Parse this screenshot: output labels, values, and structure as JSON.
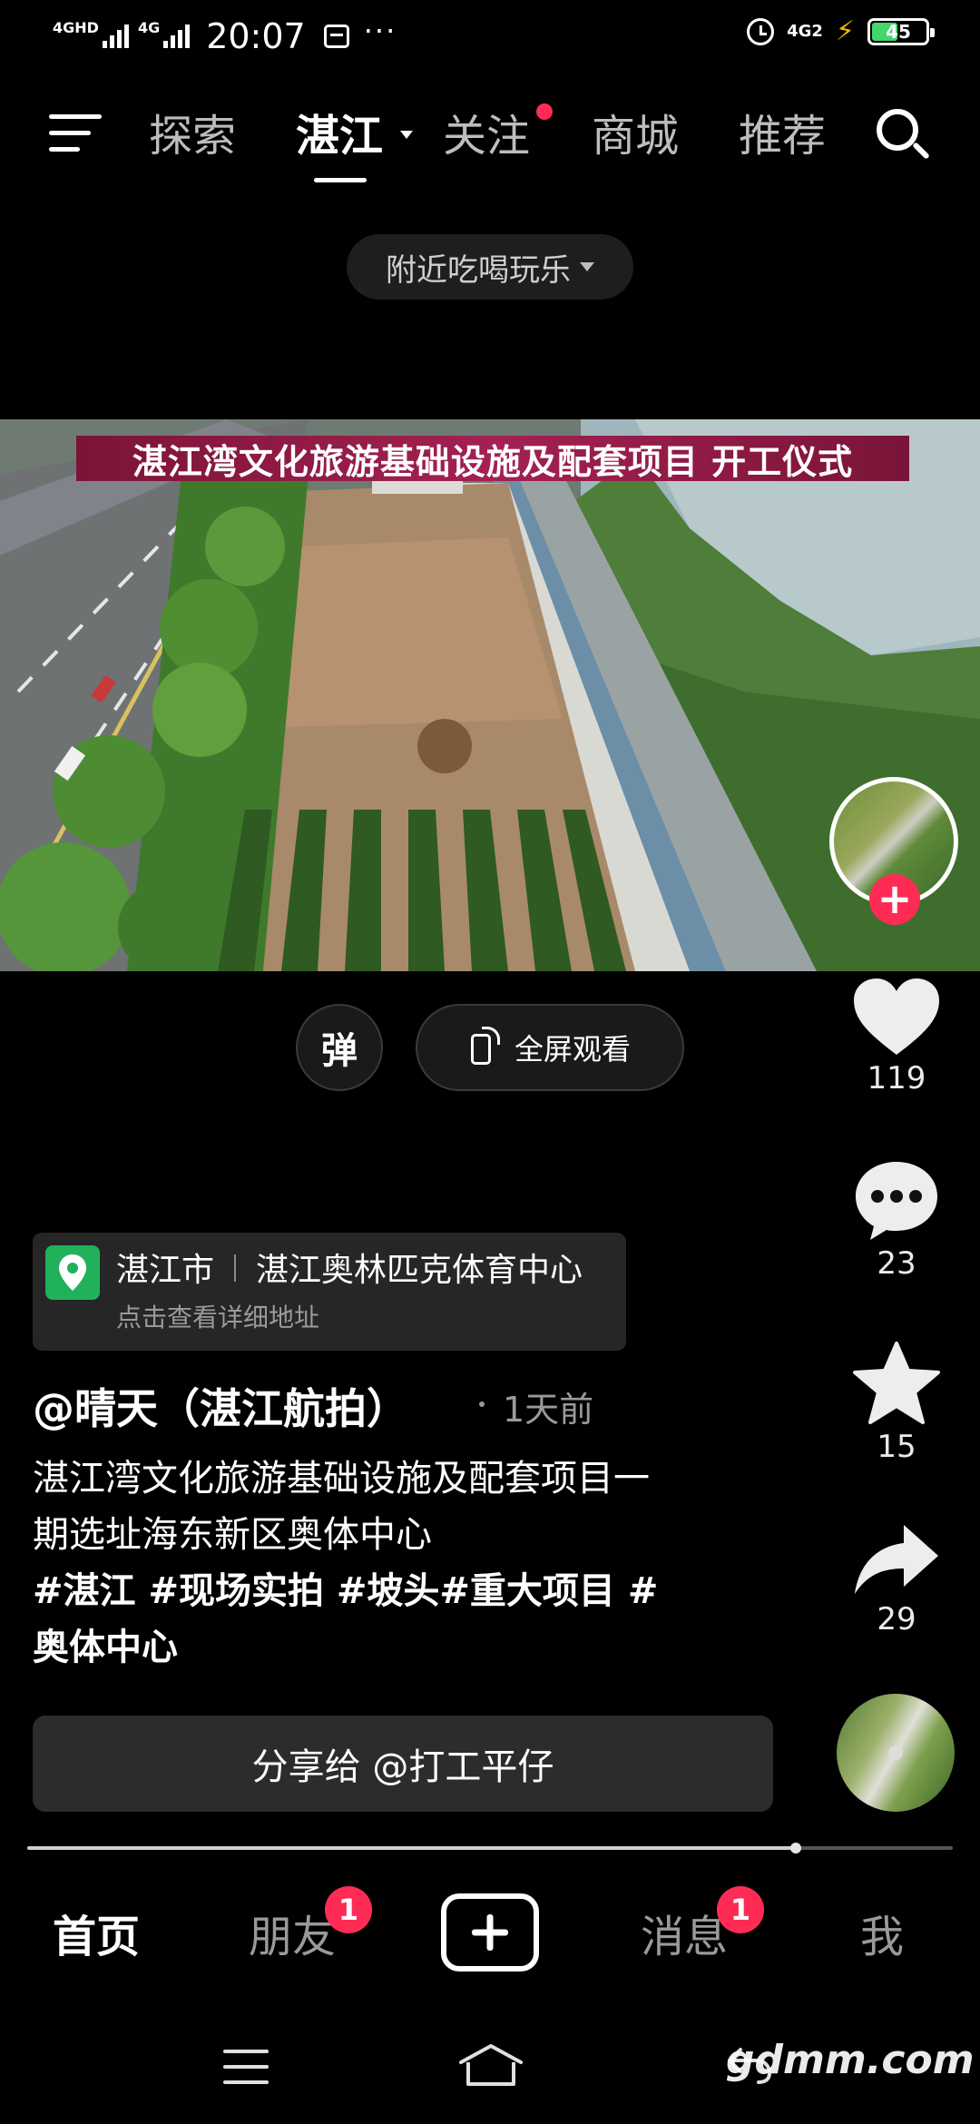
{
  "status_bar": {
    "network_1": "4GHD",
    "network_2": "4G",
    "time": "20:07",
    "more": "···",
    "cellular": "4G2",
    "battery": "45"
  },
  "top_nav": {
    "tabs": [
      "探索",
      "湛江",
      "关注",
      "商城",
      "推荐"
    ],
    "active_tab": "湛江"
  },
  "nearby_filter": "附近吃喝玩乐",
  "video": {
    "banner": "湛江湾文化旅游基础设施及配套项目 开工仪式"
  },
  "controls": {
    "danmu_label": "弹",
    "fullscreen_label": "全屏观看"
  },
  "actions": {
    "likes": "119",
    "comments": "23",
    "favorites": "15",
    "shares": "29"
  },
  "location": {
    "city": "湛江市",
    "place": "湛江奥林匹克体育中心",
    "hint": "点击查看详细地址"
  },
  "post": {
    "author": "@晴天（湛江航拍）",
    "time_ago": "1天前",
    "desc_line1": "湛江湾文化旅游基础设施及配套项目一",
    "desc_line2": "期选址海东新区奥体中心",
    "tags_line1": "#湛江 #现场实拍 #坡头#重大项目 #",
    "tags_line2": "奥体中心"
  },
  "share_bar": "分享给 @打工平仔",
  "progress": {
    "fraction": 0.83
  },
  "bottom_nav": {
    "home": "首页",
    "friends": "朋友",
    "friends_badge": "1",
    "messages": "消息",
    "messages_badge": "1",
    "me": "我"
  },
  "watermark": "gdmm.com",
  "colors": {
    "accent_red": "#fe2c55",
    "location_green": "#20b15a",
    "banner_magenta": "#a32152"
  }
}
